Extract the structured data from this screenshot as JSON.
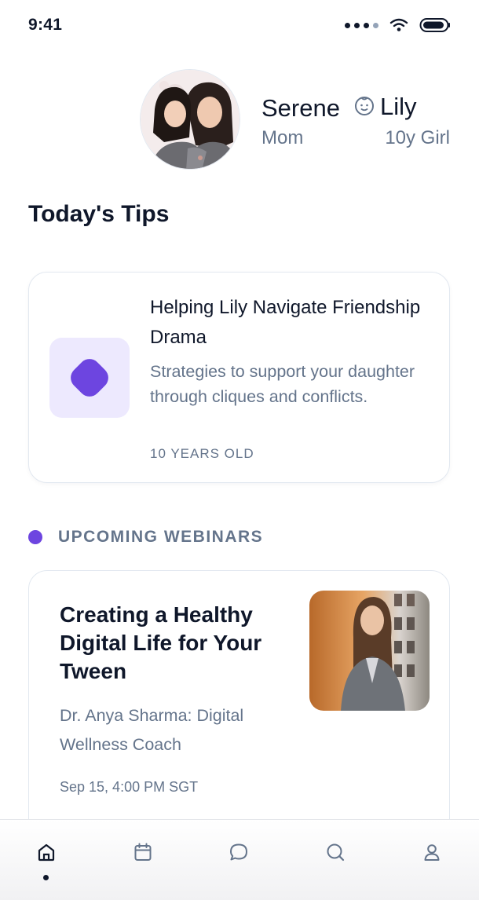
{
  "status_bar": {
    "time": "9:41"
  },
  "profile": {
    "parent_name": "Serene",
    "parent_role": "Mom",
    "child_name": "Lily",
    "child_age": "10y Girl"
  },
  "tips": {
    "section_title": "Today's Tips",
    "card": {
      "title": "Helping Lily Navigate Friendship Drama",
      "description": "Strategies to support your daughter through cliques and conflicts.",
      "age_tag": "10 YEARS OLD",
      "icon": "diamond-icon"
    }
  },
  "webinars": {
    "section_label": "UPCOMING WEBINARS",
    "card": {
      "title": "Creating a Healthy Digital Life for Your Tween",
      "speaker": "Dr. Anya Sharma: Digital Wellness Coach",
      "date": "Sep 15, 4:00 PM SGT"
    }
  },
  "tab_bar": {
    "items": [
      {
        "icon": "home-icon",
        "active": true
      },
      {
        "icon": "calendar-icon",
        "active": false
      },
      {
        "icon": "chat-icon",
        "active": false
      },
      {
        "icon": "search-icon",
        "active": false
      },
      {
        "icon": "profile-icon",
        "active": false
      }
    ]
  },
  "colors": {
    "accent": "#6d45e0",
    "accent_light": "#ede9fe",
    "text_primary": "#0f172a",
    "text_secondary": "#64748b"
  }
}
